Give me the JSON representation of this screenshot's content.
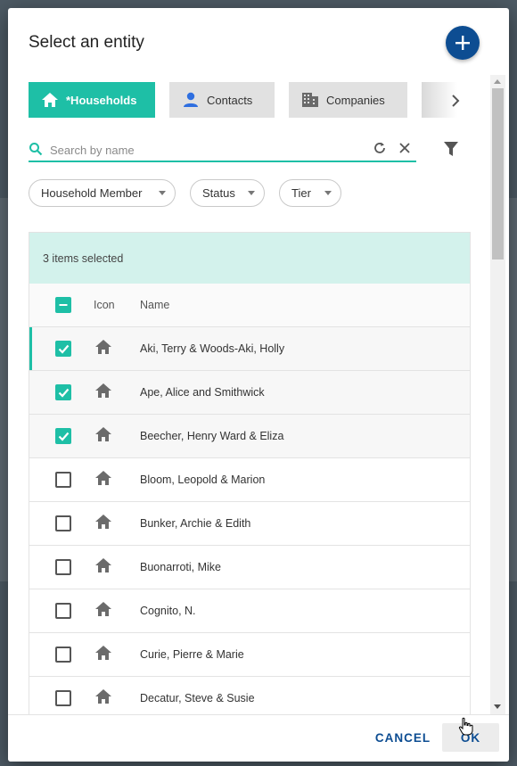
{
  "dialog": {
    "title": "Select an entity"
  },
  "tabs": [
    {
      "label": "*Households",
      "icon": "home-icon",
      "active": true
    },
    {
      "label": "Contacts",
      "icon": "person-icon",
      "active": false
    },
    {
      "label": "Companies",
      "icon": "building-icon",
      "active": false
    }
  ],
  "search": {
    "placeholder": "Search by name",
    "value": ""
  },
  "filters": [
    {
      "label": "Household Member"
    },
    {
      "label": "Status"
    },
    {
      "label": "Tier"
    }
  ],
  "grid": {
    "selection_summary": "3 items selected",
    "columns": {
      "icon": "Icon",
      "name": "Name"
    },
    "rows": [
      {
        "name": "Aki, Terry & Woods-Aki, Holly",
        "checked": true
      },
      {
        "name": "Ape, Alice and Smithwick",
        "checked": true
      },
      {
        "name": "Beecher, Henry Ward & Eliza",
        "checked": true
      },
      {
        "name": "Bloom, Leopold & Marion",
        "checked": false
      },
      {
        "name": "Bunker, Archie & Edith",
        "checked": false
      },
      {
        "name": "Buonarroti, Mike",
        "checked": false
      },
      {
        "name": "Cognito, N.",
        "checked": false
      },
      {
        "name": "Curie, Pierre & Marie",
        "checked": false
      },
      {
        "name": "Decatur, Steve & Susie",
        "checked": false
      }
    ]
  },
  "footer": {
    "cancel_label": "CANCEL",
    "ok_label": "OK"
  },
  "colors": {
    "accent": "#1ebfa6",
    "primary": "#0d4d92",
    "selection_bar": "#d3f2ec"
  }
}
